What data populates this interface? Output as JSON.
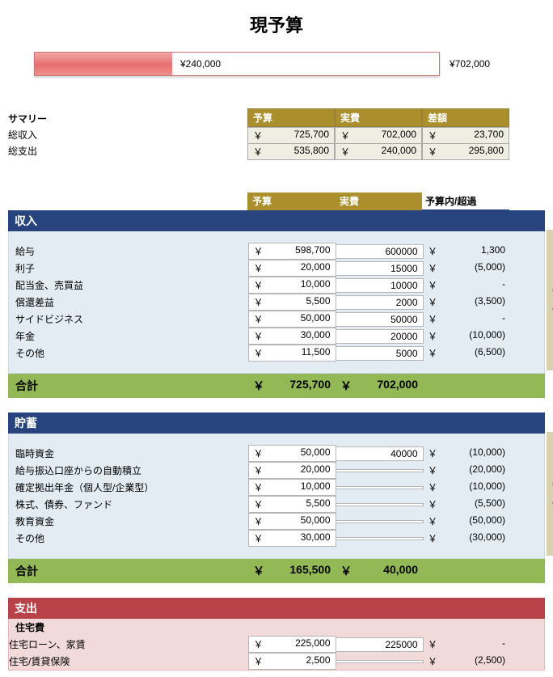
{
  "title": "現予算",
  "bar": {
    "inside": "¥240,000",
    "outside": "¥702,000",
    "fill_pct": 34
  },
  "summary": {
    "row_label": "サマリー",
    "headers": [
      "予算",
      "実費",
      "差額"
    ],
    "rows": [
      {
        "label": "総収入",
        "budget": "725,700",
        "actual": "702,000",
        "diff": "23,700"
      },
      {
        "label": "総支出",
        "budget": "535,800",
        "actual": "240,000",
        "diff": "295,800"
      }
    ]
  },
  "section_headers": {
    "budget": "予算",
    "actual": "実費",
    "diff": "予算内/超過"
  },
  "income": {
    "title": "収入",
    "side": "毎月",
    "rows": [
      {
        "label": "給与",
        "budget": "598,700",
        "actual": "600000",
        "diff": "1,300",
        "neg": false
      },
      {
        "label": "利子",
        "budget": "20,000",
        "actual": "15000",
        "diff": "(5,000)",
        "neg": true
      },
      {
        "label": "配当金、売買益",
        "budget": "10,000",
        "actual": "10000",
        "diff": "-",
        "neg": false
      },
      {
        "label": "償還差益",
        "budget": "5,500",
        "actual": "2000",
        "diff": "(3,500)",
        "neg": true
      },
      {
        "label": "サイドビジネス",
        "budget": "50,000",
        "actual": "50000",
        "diff": "-",
        "neg": false
      },
      {
        "label": "年金",
        "budget": "30,000",
        "actual": "20000",
        "diff": "(10,000)",
        "neg": true
      },
      {
        "label": "その他",
        "budget": "11,500",
        "actual": "5000",
        "diff": "(6,500)",
        "neg": true
      }
    ],
    "total_label": "合計",
    "total_budget": "725,700",
    "total_actual": "702,000"
  },
  "savings": {
    "title": "貯蓄",
    "side": "毎月",
    "rows": [
      {
        "label": "臨時資金",
        "budget": "50,000",
        "actual": "40000",
        "diff": "(10,000)"
      },
      {
        "label": "給与振込口座からの自動積立",
        "budget": "20,000",
        "actual": "",
        "diff": "(20,000)"
      },
      {
        "label": "確定拠出年金（個人型/企業型）",
        "budget": "10,000",
        "actual": "",
        "diff": "(10,000)"
      },
      {
        "label": "株式、債券、ファンド",
        "budget": "5,500",
        "actual": "",
        "diff": "(5,500)"
      },
      {
        "label": "教育資金",
        "budget": "50,000",
        "actual": "",
        "diff": "(50,000)"
      },
      {
        "label": "その他",
        "budget": "30,000",
        "actual": "",
        "diff": "(30,000)"
      }
    ],
    "total_label": "合計",
    "total_budget": "165,500",
    "total_actual": "40,000"
  },
  "expense": {
    "title": "支出",
    "sub": "住宅費",
    "rows": [
      {
        "label": "住宅ローン、家賃",
        "budget": "225,000",
        "actual": "225000",
        "diff": "-",
        "green": false
      },
      {
        "label": "住宅/賃貸保険",
        "budget": "2,500",
        "actual": "",
        "diff": "(2,500)",
        "green": true
      }
    ]
  },
  "currency": "￥"
}
